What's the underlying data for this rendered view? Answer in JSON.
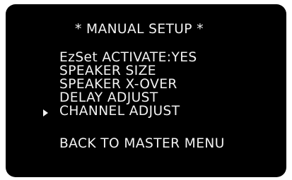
{
  "menu": {
    "title": "* MANUAL SETUP *",
    "items": [
      {
        "label": "EzSet ACTIVATE:YES"
      },
      {
        "label": "SPEAKER SIZE"
      },
      {
        "label": "SPEAKER X-OVER"
      },
      {
        "label": "DELAY ADJUST"
      },
      {
        "label": "CHANNEL ADJUST",
        "selected": true
      }
    ],
    "back_label": "BACK TO MASTER MENU"
  },
  "colors": {
    "background": "#000000",
    "text": "#f2f2f2"
  },
  "icons": {
    "cursor": "selection-cursor-icon"
  }
}
